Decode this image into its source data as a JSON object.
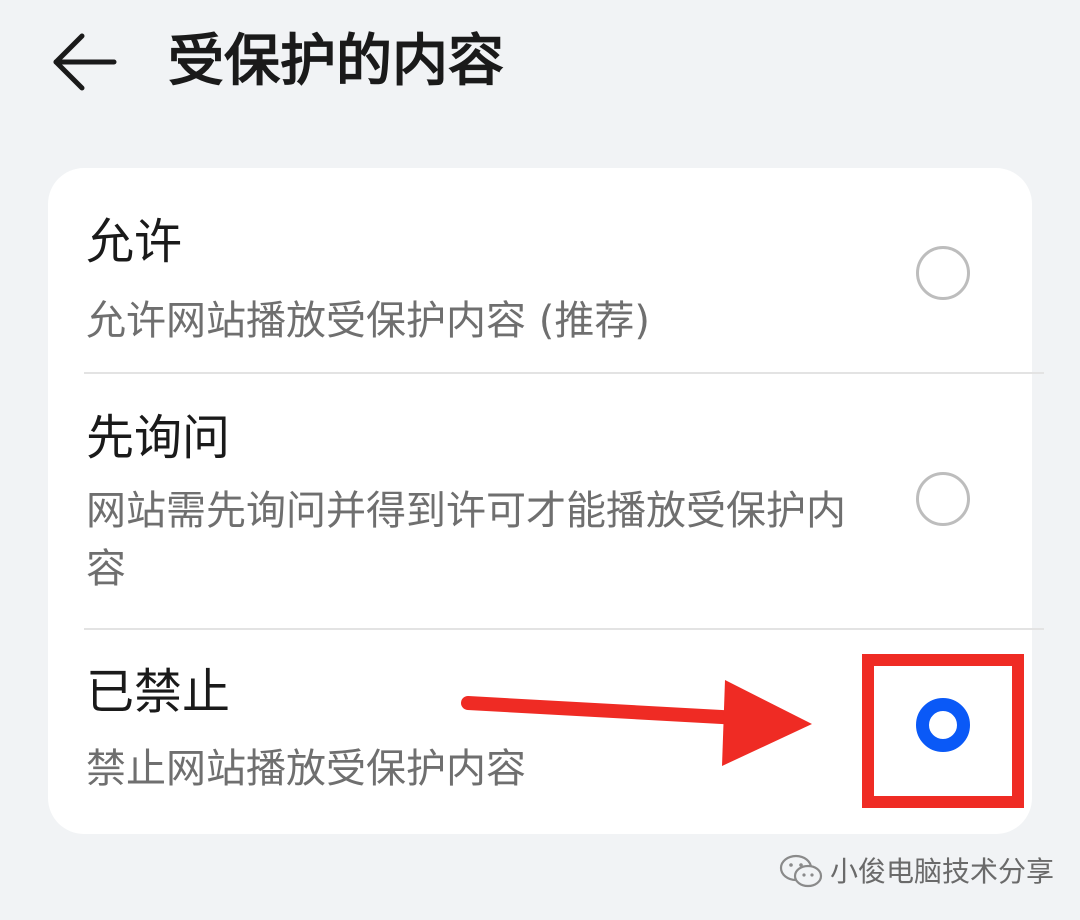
{
  "header": {
    "back_icon": "arrow-left-icon",
    "title": "受保护的内容"
  },
  "options": [
    {
      "title": "允许",
      "subtitle": "允许网站播放受保护内容 (推荐)",
      "selected": false
    },
    {
      "title": "先询问",
      "subtitle": "网站需先询问并得到许可才能播放受保护内容",
      "selected": false
    },
    {
      "title": "已禁止",
      "subtitle": "禁止网站播放受保护内容",
      "selected": true
    }
  ],
  "annotation": {
    "highlight_color": "#ef2b24",
    "arrow_icon": "red-arrow-icon"
  },
  "watermark": {
    "icon": "wechat-icon",
    "text": "小俊电脑技术分享"
  },
  "colors": {
    "background": "#f1f3f5",
    "card": "#ffffff",
    "accent": "#0a59f7",
    "title_text": "#1a1a1a",
    "subtitle_text": "#6f6f6f"
  }
}
